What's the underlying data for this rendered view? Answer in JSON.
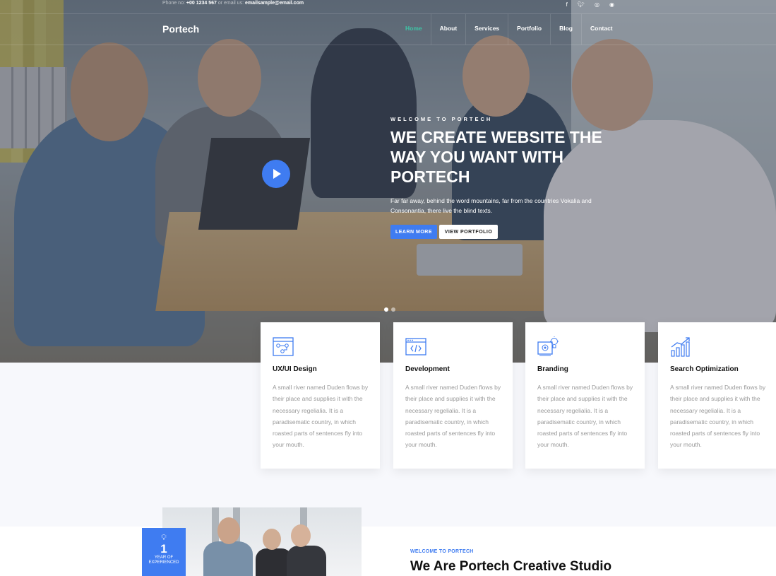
{
  "topbar": {
    "phone_label": "Phone no:",
    "phone": "+00 1234 567",
    "email_label": "or email us:",
    "email": "emailsample@email.com",
    "social": [
      "f",
      "t",
      "ig",
      "d"
    ]
  },
  "header": {
    "logo": "Portech",
    "nav": [
      "Home",
      "About",
      "Services",
      "Portfolio",
      "Blog",
      "Contact"
    ],
    "active": "Home"
  },
  "hero": {
    "subheading": "WELCOME TO PORTECH",
    "title": "WE CREATE WEBSITE THE WAY YOU WANT WITH PORTECH",
    "text": "Far far away, behind the word mountains, far from the countries Vokalia and Consonantia, there live the blind texts.",
    "btn_learn": "LEARN MORE",
    "btn_portfolio": "VIEW PORTFOLIO",
    "accent": "#3f7cf1",
    "nav_active_color": "#3ec5a7"
  },
  "services": [
    {
      "icon": "ux-design-icon",
      "title": "UX/UI Design",
      "text": "A small river named Duden flows by their place and supplies it with the necessary regelialia. It is a paradisematic country, in which roasted parts of sentences fly into your mouth."
    },
    {
      "icon": "code-window-icon",
      "title": "Development",
      "text": "A small river named Duden flows by their place and supplies it with the necessary regelialia. It is a paradisematic country, in which roasted parts of sentences fly into your mouth."
    },
    {
      "icon": "branding-icon",
      "title": "Branding",
      "text": "A small river named Duden flows by their place and supplies it with the necessary regelialia. It is a paradisematic country, in which roasted parts of sentences fly into your mouth."
    },
    {
      "icon": "growth-chart-icon",
      "title": "Search Optimization",
      "text": "A small river named Duden flows by their place and supplies it with the necessary regelialia. It is a paradisematic country, in which roasted parts of sentences fly into your mouth."
    }
  ],
  "about": {
    "badge_number": "1",
    "badge_label": "YEAR OF EXPERIENCED",
    "subheading": "WELCOME TO PORTECH",
    "title": "We Are Portech Creative Studio"
  }
}
